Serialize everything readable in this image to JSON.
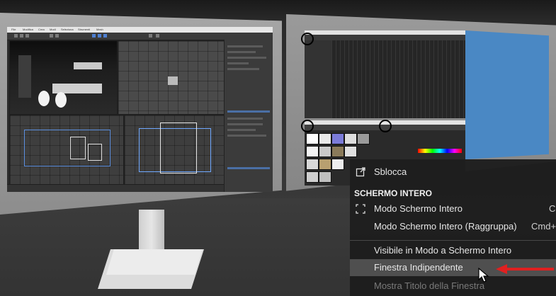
{
  "left_screen": {
    "menu_items": [
      "File",
      "Modifica",
      "Crea",
      "Modi",
      "Seleziona",
      "Strumenti",
      "Mesh"
    ]
  },
  "context_menu": {
    "unlock_label": "Sblocca",
    "unlock_icon": "external-link-icon",
    "section_fullscreen": "SCHERMO INTERO",
    "fullscreen_icon": "fullscreen-corners-icon",
    "fullscreen_mode": "Modo Schermo Intero",
    "fullscreen_mode_shortcut": "C",
    "fullscreen_group": "Modo Schermo Intero (Raggruppa)",
    "fullscreen_group_shortcut": "Cmd+",
    "visible_fullscreen": "Visibile in Modo a Schermo Intero",
    "independent_window": "Finestra Indipendente",
    "show_window_title": "Mostra Titolo della Finestra"
  },
  "colors": {
    "menu_bg": "#1e1e1e",
    "menu_selected": "#4f4f4f",
    "arrow": "#e02020",
    "blue_panel": "#4a88c4"
  }
}
